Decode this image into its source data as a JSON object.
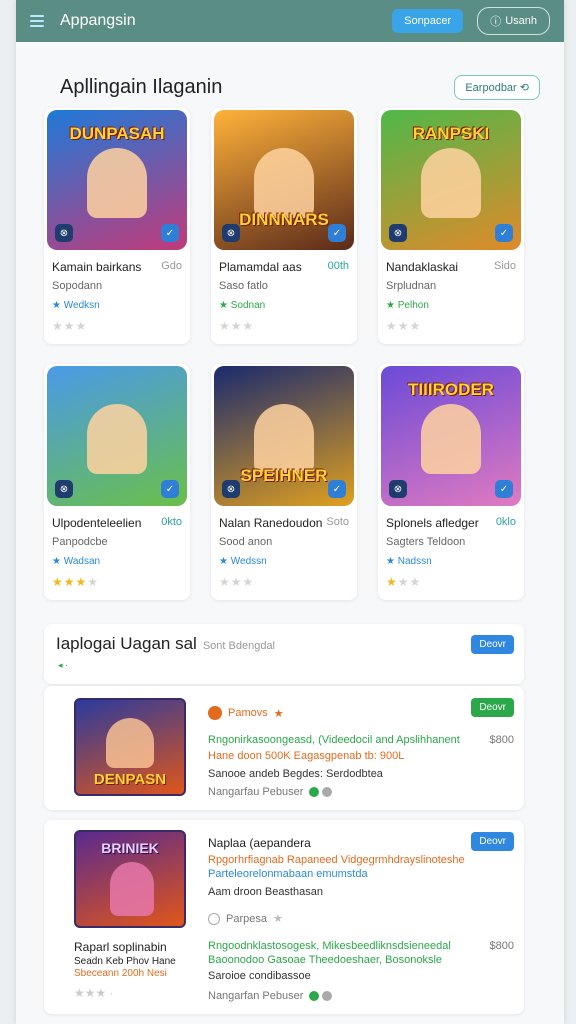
{
  "topbar": {
    "title": "Appangsin",
    "primary_btn": "Sonpacer",
    "outline_btn": "Usanh"
  },
  "section": {
    "title": "Apllingain Ilaganin",
    "btn": "Earpodbar"
  },
  "cards": [
    {
      "art": "DUNPASAH",
      "name": "Kamain bairkans",
      "tag": "Gdo",
      "sub": "Sopodann",
      "label": "Wedksn",
      "stars_on": 0,
      "stars_off": 3,
      "colors": [
        "#1e7ad8",
        "#c23a7a"
      ]
    },
    {
      "art": "DINNNARS",
      "name": "Plamamdal aas",
      "tag": "00th",
      "sub": "Saso fatlo",
      "label": "Sodnan",
      "stars_on": 0,
      "stars_off": 3,
      "colors": [
        "#ffb23a",
        "#5a2a1a"
      ]
    },
    {
      "art": "RANPSKI",
      "name": "Nandaklaskai",
      "tag": "Sido",
      "sub": "Srpludnan",
      "label": "Pelhon",
      "stars_on": 0,
      "stars_off": 3,
      "colors": [
        "#4fb84a",
        "#e08a2a"
      ]
    },
    {
      "art": "",
      "name": "Ulpodenteleelien",
      "tag": "0kto",
      "sub": "Panpodcbe",
      "label": "Wadsan",
      "stars_on": 3,
      "stars_off": 1,
      "colors": [
        "#4a9ae8",
        "#6abf4a"
      ]
    },
    {
      "art": "SPEIHNER",
      "name": "Nalan Ranedoudon",
      "tag": "Soto",
      "sub": "Sood anon",
      "label": "Wedssn",
      "stars_on": 0,
      "stars_off": 3,
      "colors": [
        "#1a2a6e",
        "#e0a020"
      ]
    },
    {
      "art": "TIIIRODER",
      "name": "Splonels afledger",
      "tag": "0klo",
      "sub": "Sagters Teldoon",
      "label": "Nadssn",
      "stars_on": 1,
      "stars_off": 2,
      "colors": [
        "#6a4ad8",
        "#e07ac0"
      ]
    }
  ],
  "panel": {
    "title": "Iaplogai Uagan sal",
    "subtitle": "Sont Bdengdal",
    "btn": "Deovr"
  },
  "item1": {
    "art": "DENPASN",
    "badge": "Pamovs",
    "btn": "Deovr",
    "desc1": "Rngonirkasoongeasd, (Videedocil and Apslihhanent",
    "desc2": "Hane doon 500K Eagasgpenab tb: 900L",
    "price": "$800",
    "line3": "Sanooe andeb Begdes: Serdodbtea",
    "footer": "Nangarfau Pebuser"
  },
  "item2": {
    "art": "BRINIEK",
    "title": "Naplaa (aepandera",
    "btn": "Deovr",
    "desc1": "Rpgorhrfiagnab Rapaneed Vidgegrmhdrayslinoteshe",
    "desc2": "Parteleorelonmabaan emumstda",
    "line3": "Aam droon Beasthasan",
    "badge": "Parpesa",
    "cap_title": "Raparl soplinabin",
    "cap_line1": "Seadn Keb Phov Hane",
    "cap_line2": "Sbeceann 200h Nesi",
    "desc3": "Rngoodnklastosogesk, Mikesbeedliknsdsieneedal",
    "desc4": "Baoonodoo Gasoae Theedoeshaer, Bosonoksle",
    "line4": "Saroioe condibassoe",
    "price": "$800",
    "footer": "Nangarfan Pebuser"
  },
  "colors": {
    "topbar": "#5a8e84",
    "primary": "#3aa4e8",
    "green": "#2ba84a",
    "blue": "#2f87e0"
  }
}
